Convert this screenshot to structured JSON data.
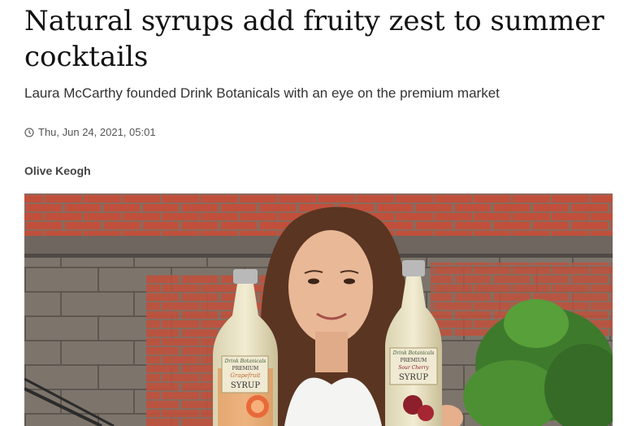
{
  "article": {
    "headline": "Natural syrups add fruity zest to summer cocktails",
    "standfirst": "Laura McCarthy founded Drink Botanicals with an eye on the premium market",
    "date": "Thu, Jun 24, 2021, 05:01",
    "author": "Olive Keogh",
    "date_icon": "clock-icon"
  },
  "photo": {
    "left_bottle": {
      "brand": "Drink Botanicals",
      "line1": "PREMIUM",
      "line2": "Grapefruit",
      "line3": "SYRUP"
    },
    "right_bottle": {
      "brand": "Drink Botanicals",
      "line1": "PREMIUM",
      "line2": "Sour Cherry",
      "line3": "SYRUP"
    }
  }
}
